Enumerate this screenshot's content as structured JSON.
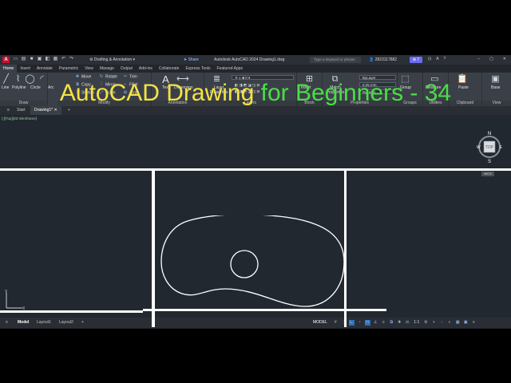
{
  "titlebar": {
    "logo": "A",
    "workspace": "Drafting & Annotation",
    "share": "Share",
    "title": "Autodesk AutoCAD 2024   Drawing1.dwg",
    "search_placeholder": "Type a keyword or phrase",
    "user": "2823117882",
    "badge": "7"
  },
  "ribbon_tabs": [
    "Home",
    "Insert",
    "Annotate",
    "Parametric",
    "View",
    "Manage",
    "Output",
    "Add-ins",
    "Collaborate",
    "Express Tools",
    "Featured Apps"
  ],
  "draw_panel": {
    "title": "Draw",
    "tools": [
      "Line",
      "Polyline",
      "Circle",
      "Arc"
    ]
  },
  "modify_panel": {
    "title": "Modify",
    "tools": [
      "Move",
      "Rotate",
      "Trim",
      "Copy",
      "Mirror",
      "Fillet",
      "Stretch",
      "Scale",
      "Array"
    ]
  },
  "annotation_panel": {
    "title": "Annotation",
    "tools": [
      "Text",
      "Dimension"
    ]
  },
  "layers_panel": {
    "title": "Layers",
    "tool": "Layer Properties"
  },
  "block_panel": {
    "title": "Block",
    "tool": "Insert"
  },
  "properties_panel": {
    "title": "Properties",
    "tool": "Match Properties",
    "color": "ByLayer",
    "lineweight": "0.25 mm",
    "linetype": "ByLayer"
  },
  "groups_panel": {
    "title": "Groups",
    "tool": "Group"
  },
  "utilities_panel": {
    "title": "Utilities",
    "tool": "Measure"
  },
  "clipboard_panel": {
    "title": "Clipboard",
    "tool": "Paste"
  },
  "view_panel": {
    "title": "View",
    "tool": "Base"
  },
  "file_tabs": {
    "start": "Start",
    "drawing": "Drawing1*"
  },
  "viewport": {
    "label": "[-][Top][2D Wireframe]"
  },
  "headline": {
    "part1": "AutoCAD Drawing ",
    "part2": "for Beginners - 34"
  },
  "viewcube": {
    "n": "N",
    "s": "S",
    "w": "W",
    "e": "E",
    "face": "TOP",
    "wcs": "WCS"
  },
  "ucs": {
    "x": "X",
    "y": "Y"
  },
  "layout_tabs": [
    "Model",
    "Layout1",
    "Layout2"
  ],
  "status": {
    "model": "MODEL",
    "scale": "1:1"
  },
  "colors": {
    "headline_yellow": "#f5e342",
    "headline_green": "#4ade45",
    "canvas": "#212830"
  }
}
